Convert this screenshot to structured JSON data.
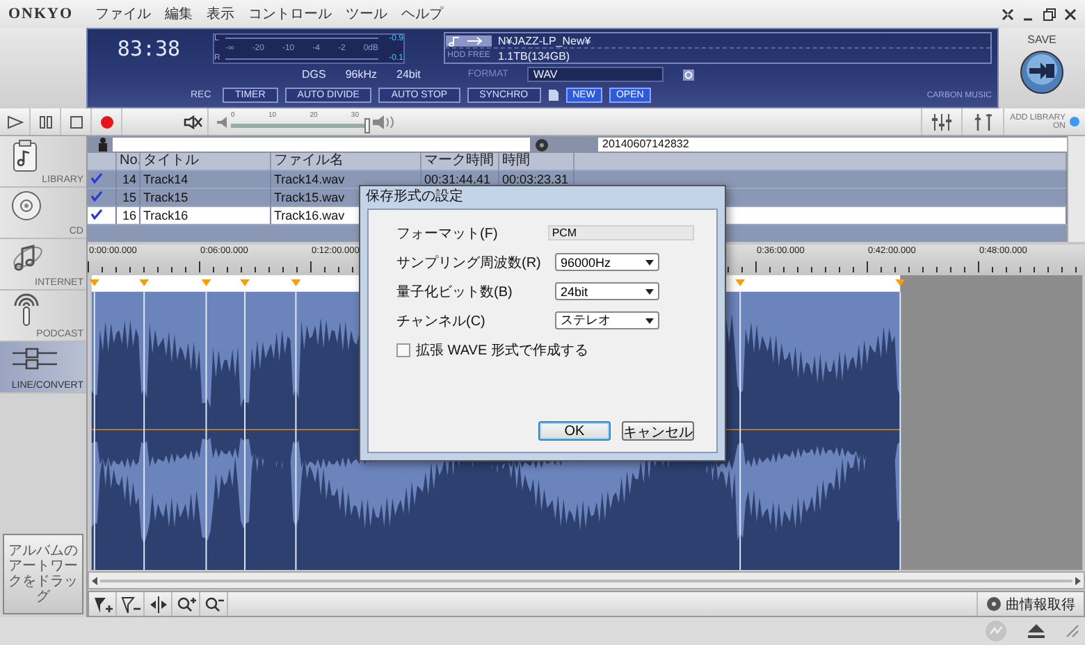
{
  "menu": {
    "logo": "ONKYO",
    "items": [
      "ファイル",
      "編集",
      "表示",
      "コントロール",
      "ツール",
      "ヘルプ"
    ]
  },
  "display": {
    "time": "83:38",
    "meter": {
      "channels": [
        "L",
        "R"
      ],
      "scale": [
        "-∞",
        "-20",
        "-10",
        "-4",
        "-2",
        "0dB"
      ],
      "peaks": [
        "-0.9",
        "-0.1"
      ]
    },
    "folder": "N¥JAZZ-LP_New¥",
    "hdd_free_label": "HDD FREE",
    "hdd_free": "1.1TB(134GB)",
    "format_info": [
      "DGS",
      "96kHz",
      "24bit"
    ],
    "format_label": "FORMAT",
    "format": "WAV",
    "rec_label": "REC",
    "rec_buttons": [
      "TIMER",
      "AUTO DIVIDE",
      "AUTO STOP",
      "SYNCHRO"
    ],
    "file_buttons": [
      "NEW",
      "OPEN"
    ],
    "brand": "CARBON MUSIC"
  },
  "save": {
    "label": "SAVE"
  },
  "transport": {
    "volume": {
      "scale": [
        "0",
        "10",
        "20",
        "30"
      ],
      "level": 1.0
    },
    "add_library": {
      "label": "ADD LIBRARY",
      "state": "ON",
      "on": true
    }
  },
  "sidebar": {
    "items": [
      {
        "label": "LIBRARY",
        "kind": "library",
        "selected": false
      },
      {
        "label": "CD",
        "kind": "cd",
        "selected": false
      },
      {
        "label": "INTERNET",
        "kind": "internet",
        "selected": false
      },
      {
        "label": "PODCAST",
        "kind": "podcast",
        "selected": false
      },
      {
        "label": "LINE/CONVERT",
        "kind": "line",
        "selected": true
      }
    ],
    "artwork_hint": "アルバムのアートワークをドラッグ"
  },
  "session": "20140607142832",
  "table": {
    "columns": [
      "No.",
      "タイトル",
      "ファイル名",
      "マーク時間",
      "時間"
    ],
    "rows": [
      {
        "checked": true,
        "selected": false,
        "cells": [
          "14",
          "Track14",
          "Track14.wav",
          "00:31:44.41",
          "00:03:23.31"
        ]
      },
      {
        "checked": true,
        "selected": false,
        "cells": [
          "15",
          "Track15",
          "Track15.wav"
        ]
      },
      {
        "checked": true,
        "selected": true,
        "cells": [
          "16",
          "Track16",
          "Track16.wav"
        ]
      }
    ]
  },
  "timeline": {
    "labels_left": [
      "0:00:00.000",
      "0:06:00.000",
      "0:12:00.000"
    ],
    "labels_right": [
      "0:36:00.000",
      "0:42:00.000",
      "0:48:00.000"
    ]
  },
  "editor_toolbar": {
    "fetch_info": "曲情報取得"
  },
  "dialog": {
    "title": "保存形式の設定",
    "format_label": "フォーマット(F)",
    "format_value": "PCM",
    "selects": [
      {
        "label": "サンプリング周波数(R)",
        "value": "96000Hz"
      },
      {
        "label": "量子化ビット数(B)",
        "value": "24bit"
      },
      {
        "label": "チャンネル(C)",
        "value": "ステレオ"
      }
    ],
    "checkbox": {
      "label": "拡張 WAVE 形式で作成する",
      "checked": false
    },
    "buttons": [
      {
        "label": "OK",
        "default": true
      },
      {
        "label": "キャンセル",
        "default": false
      }
    ]
  }
}
